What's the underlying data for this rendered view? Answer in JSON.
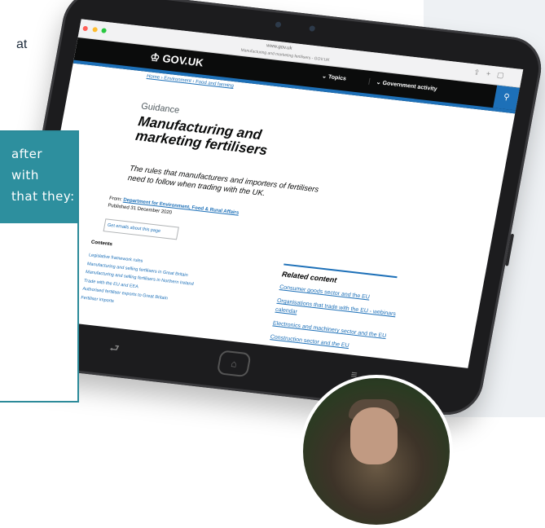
{
  "page": {
    "intro_text": "at",
    "callout_lines": [
      "after",
      "with",
      "that they:"
    ]
  },
  "browser": {
    "url": "www.gov.uk",
    "tab_text": "Manufacturing and marketing fertilisers - GOV.UK"
  },
  "gov": {
    "logo": "GOV.UK",
    "nav_topics": "Topics",
    "nav_activity": "Government activity",
    "search_icon": "search-icon"
  },
  "article": {
    "breadcrumb": "Home  ›  Environment  ›  Food and farming",
    "label": "Guidance",
    "title": "Manufacturing and marketing fertilisers",
    "lead": "The rules that manufacturers and importers of fertilisers need to follow when trading with the UK.",
    "from_label": "From:",
    "from_link": "Department for Environment, Food & Rural Affairs",
    "published": "Published 31 December 2020",
    "email_button": "Get emails about this page",
    "contents_label": "Contents",
    "contents": [
      "Legislative framework rules",
      "Manufacturing and selling fertilisers in Great Britain",
      "Manufacturing and selling fertilisers in Northern Ireland",
      "Trade with the EU and EEA",
      "Authorised fertiliser exports to Great Britain",
      "Fertiliser imports"
    ]
  },
  "related": {
    "title": "Related content",
    "items": [
      "Consumer goods sector and the EU",
      "Organisations that trade with the EU - webinars calendar",
      "Electronics and machinery sector and the EU",
      "Construction sector and the EU"
    ]
  }
}
